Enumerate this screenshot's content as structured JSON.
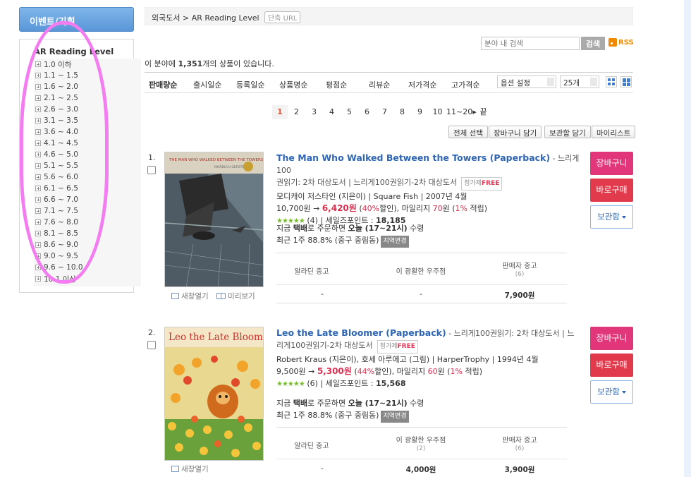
{
  "sidebar": {
    "event_tab": "이벤트/기획",
    "title": "AR Reading Level",
    "items": [
      "1.0 이하",
      "1.1 ~ 1.5",
      "1.6 ~ 2.0",
      "2.1 ~ 2.5",
      "2.6 ~ 3.0",
      "3.1 ~ 3.5",
      "3.6 ~ 4.0",
      "4.1 ~ 4.5",
      "4.6 ~ 5.0",
      "5.1 ~ 5.5",
      "5.6 ~ 6.0",
      "6.1 ~ 6.5",
      "6.6 ~ 7.0",
      "7.1 ~ 7.5",
      "7.6 ~ 8.0",
      "8.1 ~ 8.5",
      "8.6 ~ 9.0",
      "9.0 ~ 9.5",
      "9.6 ~ 10.0",
      "10.1 이상"
    ]
  },
  "breadcrumb": {
    "text": "외국도서 > AR Reading Level",
    "url_btn": "단축 URL"
  },
  "search": {
    "placeholder": "분야 내 검색",
    "button": "검색",
    "rss": "RSS"
  },
  "count": {
    "prefix": "이 분야에 ",
    "num": "1,351",
    "suffix": "개의 상품이 있습니다."
  },
  "sort": {
    "tabs": [
      "판매량순",
      "출시일순",
      "등록일순",
      "상품명순",
      "평점순",
      "리뷰순",
      "저가격순",
      "고가격순"
    ],
    "option_select": "옵션 설정",
    "per_page": "25개"
  },
  "pager": [
    "1",
    "2",
    "3",
    "4",
    "5",
    "6",
    "7",
    "8",
    "9",
    "10",
    "11~20▸",
    "끝"
  ],
  "actions": [
    "전체 선택",
    "장바구니 담기",
    "보관함 담기",
    "마이리스트"
  ],
  "products": [
    {
      "num": "1.",
      "title": "The Man Who Walked Between the Towers (Paperback)",
      "series_a": " - 느리게100",
      "series_b": "권읽기: 2차 대상도서  |  느리게100권읽기-2차 대상도서",
      "tag_prefix": "정가제",
      "tag_free": "FREE",
      "author": "모디캐이 저스타인 (지은이) | Square Fish | 2007년 4월",
      "list_price": "10,700원 → ",
      "sale_price": "6,420원",
      "discount_a": " (",
      "discount_pct": "40%",
      "discount_b": "할인), 마일리지 ",
      "mileage": "70",
      "mileage_b": "원 (",
      "mileage_pct": "1%",
      "mileage_c": " 적립)",
      "stars": "★★★★★",
      "reviews": " (4) | 세일즈포인트 : ",
      "sales_point": "18,185",
      "delivery_a": "지금 ",
      "delivery_b": "택배",
      "delivery_c": "로 주문하면 ",
      "delivery_d": "오늘 (17~21시)",
      "delivery_e": " 수령",
      "recent": "최근 1주 88.8% (중구 중림동)",
      "area_tag": "지역변경",
      "cover_title": "THE MAN WHO WALKED BETWEEN THE TOWERS",
      "cover_author": "MORDICAI GERSTEIN",
      "used": {
        "h1": "알라딘 중고",
        "h2": "이 광활한 우주점",
        "h3": "판매자 중고",
        "s3": "(6)",
        "v1": "-",
        "v2": "-",
        "v3": "7,900원"
      },
      "new_window": "새창열기",
      "preview": "미리보기"
    },
    {
      "num": "2.",
      "title": "Leo the Late Bloomer (Paperback)",
      "series_a": " - 느리게100권읽기: 2차 대상도서  |  느",
      "series_b": "리게100권읽기-2차 대상도서",
      "tag_prefix": "정가제",
      "tag_free": "FREE",
      "author": "Robert Kraus (지은이), 호세 아루에고 (그림) | HarperTrophy | 1994년 4월",
      "list_price": "9,500원 → ",
      "sale_price": "5,300원",
      "discount_a": " (",
      "discount_pct": "44%",
      "discount_b": "할인), 마일리지 ",
      "mileage": "60",
      "mileage_b": "원 (",
      "mileage_pct": "1%",
      "mileage_c": " 적립)",
      "stars": "★★★★★",
      "reviews": " (6) | 세일즈포인트 : ",
      "sales_point": "15,568",
      "delivery_a": "지금 ",
      "delivery_b": "택배",
      "delivery_c": "로 주문하면 ",
      "delivery_d": "오늘 (17~21시)",
      "delivery_e": " 수령",
      "recent": "최근 1주 88.8% (중구 중림동)",
      "area_tag": "지역변경",
      "cover_title": "Leo the Late Bloomer",
      "used": {
        "h1": "알라딘 중고",
        "h2": "이 광활한 우주점",
        "s2": "(2)",
        "h3": "판매자 중고",
        "s3": "(6)",
        "v1": "-",
        "v2": "4,000원",
        "v3": "3,900원"
      },
      "new_window": "새창열기"
    }
  ],
  "buttons": {
    "cart": "장바구니",
    "buy": "바로구매",
    "keep": "보관함"
  },
  "colors": {
    "cart": "#e2367b",
    "buy": "#e03a4c",
    "title_link": "#2f66b3",
    "price": "#d9304f",
    "marker": "#f37cf0"
  }
}
